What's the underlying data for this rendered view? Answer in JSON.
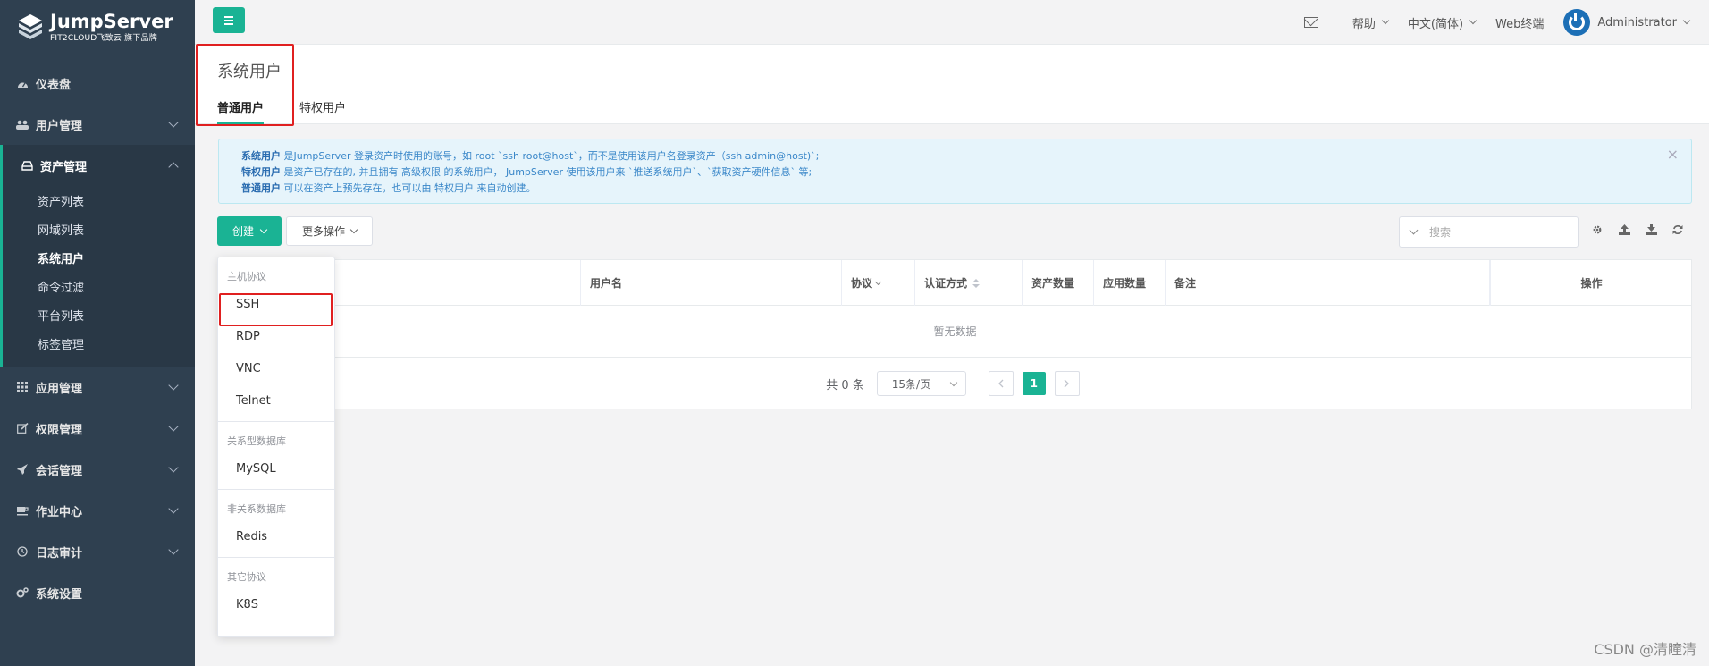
{
  "brand": {
    "name": "JumpServer",
    "tagline": "FIT2CLOUD飞致云 旗下品牌"
  },
  "sidebar": {
    "items": [
      {
        "label": "仪表盘",
        "icon": "dashboard-icon"
      },
      {
        "label": "用户管理",
        "icon": "users-icon"
      },
      {
        "label": "资产管理",
        "icon": "inbox-icon",
        "expanded": true
      },
      {
        "label": "应用管理",
        "icon": "grid-icon"
      },
      {
        "label": "权限管理",
        "icon": "edit-icon"
      },
      {
        "label": "会话管理",
        "icon": "rocket-icon"
      },
      {
        "label": "作业中心",
        "icon": "coffee-icon"
      },
      {
        "label": "日志审计",
        "icon": "history-icon"
      },
      {
        "label": "系统设置",
        "icon": "gears-icon"
      }
    ],
    "asset_sub": [
      "资产列表",
      "网域列表",
      "系统用户",
      "命令过滤",
      "平台列表",
      "标签管理"
    ],
    "active_sub": "系统用户"
  },
  "header": {
    "help": "帮助",
    "language": "中文(简体)",
    "web_terminal": "Web终端",
    "user": "Administrator"
  },
  "page": {
    "title": "系统用户",
    "tabs": [
      "普通用户",
      "特权用户"
    ]
  },
  "alert": {
    "line1_bold": "系统用户",
    "line1": " 是JumpServer 登录资产时使用的账号，如 root `ssh root@host`，而不是使用该用户名登录资产（ssh admin@host)`;",
    "line2_bold": "特权用户",
    "line2": " 是资产已存在的, 并且拥有 高级权限 的系统用户， JumpServer 使用该用户来 `推送系统用户`、`获取资产硬件信息` 等;",
    "line3_bold": "普通用户",
    "line3": " 可以在资产上预先存在，也可以由 特权用户 来自动创建。"
  },
  "toolbar": {
    "create": "创建",
    "more": "更多操作",
    "search_placeholder": "搜索"
  },
  "table": {
    "columns": [
      "用户名",
      "协议",
      "认证方式",
      "资产数量",
      "应用数量",
      "备注",
      "操作"
    ],
    "empty": "暂无数据"
  },
  "pager": {
    "total": "共 0 条",
    "page_size": "15条/页",
    "current": "1"
  },
  "dropdown": {
    "groups": [
      {
        "label": "主机协议",
        "items": [
          "SSH",
          "RDP",
          "VNC",
          "Telnet"
        ]
      },
      {
        "label": "关系型数据库",
        "items": [
          "MySQL"
        ]
      },
      {
        "label": "非关系数据库",
        "items": [
          "Redis"
        ]
      },
      {
        "label": "其它协议",
        "items": [
          "K8S"
        ]
      }
    ]
  },
  "watermark": "CSDN @清瞳清",
  "colors": {
    "accent": "#1ab394",
    "sidebar": "#2f4050",
    "highlight": "#e02020"
  }
}
